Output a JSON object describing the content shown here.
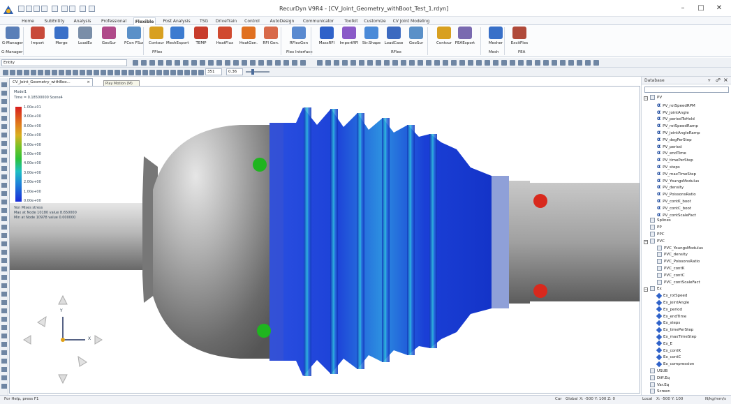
{
  "app": {
    "title": "RecurDyn V9R4 - [CV_Joint_Geometry_withBoot_Test_1.rdyn]"
  },
  "ribbon_tabs": [
    "Home",
    "SubEntity",
    "Analysis",
    "Professional",
    "Flexible",
    "Post Analysis",
    "TSG",
    "DriveTrain",
    "Control",
    "AutoDesign",
    "Communicator",
    "Toolkit",
    "Customize",
    "CV Joint Modeling"
  ],
  "active_tab": "Flexible",
  "ribbon": {
    "buttons": [
      "G-Manager",
      "Import",
      "Merge",
      "LoadEx",
      "GeoSur",
      "FCon FSur",
      "Contour",
      "MeshExport",
      "TEMP",
      "HeatFlux",
      "HeatGen.",
      "RFI Gen.",
      "RFlexGen",
      "MassRFI",
      "ImportRFI",
      "Str.Shape",
      "LoadCase",
      "GeoSur",
      "Contour",
      "FEAExport",
      "Mesher",
      "ExcitFlex"
    ],
    "groups": [
      "G-Manager",
      "FFlex",
      "Flex Interface",
      "RFlex",
      "Mesh",
      "FEA"
    ]
  },
  "toolbar": {
    "mode_field": "Entity",
    "frame_field": "351",
    "value_field": "0.36"
  },
  "tooltip": "Play Motion (M)",
  "document_tab": "CV_Joint_Geometry_withBoo...",
  "viewport": {
    "model_label": "Model1",
    "time_label": "Time = 0.18500000 Scene4",
    "legend_values": [
      "1.00e+01",
      "9.00e+00",
      "8.00e+00",
      "7.00e+00",
      "6.00e+00",
      "5.00e+00",
      "4.00e+00",
      "3.00e+00",
      "2.00e+00",
      "1.00e+00",
      "0.00e+00"
    ],
    "result_label": "Von Mises stress",
    "max_label": "Max at Node 10180 value 8.650000",
    "min_label": "Min at Node 10978 value 0.000000",
    "axis_y": "Y",
    "axis_x": "X"
  },
  "colors": {
    "accent": "#1e5bb5",
    "boot_blue": "#1a3fd6",
    "boot_cyan": "#23c4d8",
    "marker_green": "#1fb51f",
    "marker_red": "#d8291d"
  },
  "panel": {
    "title": "Database",
    "tree": [
      {
        "kind": "group",
        "label": "PV",
        "level": 1
      },
      {
        "kind": "alpha",
        "label": "PV_rotSpeedRPM",
        "level": 2
      },
      {
        "kind": "alpha",
        "label": "PV_jointAngle",
        "level": 2
      },
      {
        "kind": "alpha",
        "label": "PV_periodToHold",
        "level": 2
      },
      {
        "kind": "alpha",
        "label": "PV_rotSpeedRamp",
        "level": 2
      },
      {
        "kind": "alpha",
        "label": "PV_jointAngleRamp",
        "level": 2
      },
      {
        "kind": "alpha",
        "label": "PV_degPerStep",
        "level": 2
      },
      {
        "kind": "alpha",
        "label": "PV_period",
        "level": 2
      },
      {
        "kind": "alpha",
        "label": "PV_endTime",
        "level": 2
      },
      {
        "kind": "alpha",
        "label": "PV_timePerStep",
        "level": 2
      },
      {
        "kind": "alpha",
        "label": "PV_steps",
        "level": 2
      },
      {
        "kind": "alpha",
        "label": "PV_maxTimeStep",
        "level": 2
      },
      {
        "kind": "alpha",
        "label": "PV_YoungsModulus",
        "level": 2
      },
      {
        "kind": "alpha",
        "label": "PV_density",
        "level": 2
      },
      {
        "kind": "alpha",
        "label": "PV_PoissonsRatio",
        "level": 2
      },
      {
        "kind": "alpha",
        "label": "PV_contK_boot",
        "level": 2
      },
      {
        "kind": "alpha",
        "label": "PV_contC_boot",
        "level": 2
      },
      {
        "kind": "alpha",
        "label": "PV_contScaleFact",
        "level": 2
      },
      {
        "kind": "box",
        "label": "Splines",
        "level": 1
      },
      {
        "kind": "box",
        "label": "PP",
        "level": 1
      },
      {
        "kind": "box",
        "label": "PPC",
        "level": 1
      },
      {
        "kind": "group",
        "label": "PVC",
        "level": 1
      },
      {
        "kind": "box",
        "label": "PVC_YoungsModulus",
        "level": 2
      },
      {
        "kind": "box",
        "label": "PVC_density",
        "level": 2
      },
      {
        "kind": "box",
        "label": "PVC_PoissonsRatio",
        "level": 2
      },
      {
        "kind": "box",
        "label": "PVC_contK",
        "level": 2
      },
      {
        "kind": "box",
        "label": "PVC_contC",
        "level": 2
      },
      {
        "kind": "box",
        "label": "PVC_contScaleFact",
        "level": 2
      },
      {
        "kind": "group",
        "label": "Ex",
        "level": 1
      },
      {
        "kind": "pen",
        "label": "Ex_rotSpeed",
        "level": 2
      },
      {
        "kind": "pen",
        "label": "Ex_jointAngle",
        "level": 2
      },
      {
        "kind": "pen",
        "label": "Ex_period",
        "level": 2
      },
      {
        "kind": "pen",
        "label": "Ex_endTime",
        "level": 2
      },
      {
        "kind": "pen",
        "label": "Ex_steps",
        "level": 2
      },
      {
        "kind": "pen",
        "label": "Ex_timePerStep",
        "level": 2
      },
      {
        "kind": "pen",
        "label": "Ex_maxTimeStep",
        "level": 2
      },
      {
        "kind": "pen",
        "label": "Ex_E",
        "level": 2
      },
      {
        "kind": "pen",
        "label": "Ex_contK",
        "level": 2
      },
      {
        "kind": "pen",
        "label": "Ex_contC",
        "level": 2
      },
      {
        "kind": "pen",
        "label": "Ex_compression",
        "level": 2
      },
      {
        "kind": "box",
        "label": "USUB",
        "level": 1
      },
      {
        "kind": "box",
        "label": "Diff.Eq",
        "level": 1
      },
      {
        "kind": "box",
        "label": "Var.Eq",
        "level": 1
      },
      {
        "kind": "box",
        "label": "Screen",
        "level": 1
      }
    ]
  },
  "status": {
    "help": "For Help, press F1",
    "car": "Car",
    "global": "Global",
    "coord1": "X: -500 Y: 100 Z: 0",
    "local": "Local",
    "coord2": "X: -500 Y: 100",
    "units": "N/kg/mm/s"
  }
}
